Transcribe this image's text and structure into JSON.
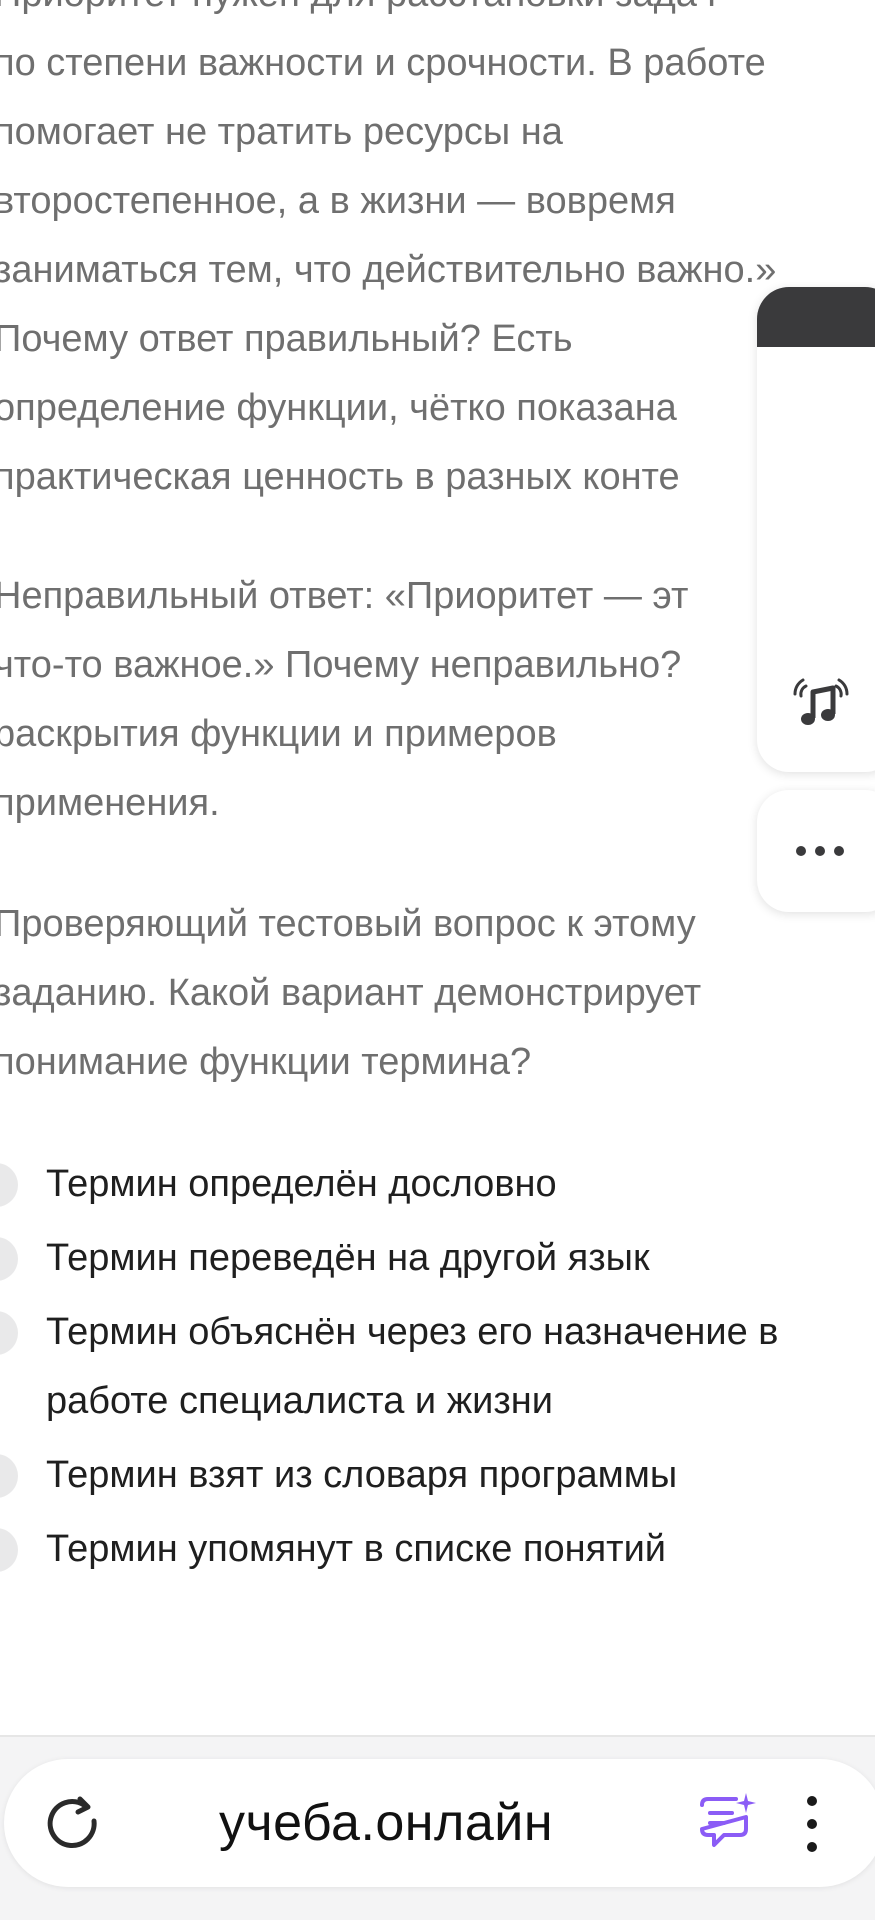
{
  "article": {
    "para1_lines": [
      "Приоритет нужен для расстановки задач",
      "по степени важности и срочности. В работе",
      "помогает не тратить ресурсы на",
      "второстепенное, а в жизни — вовремя",
      "заниматься тем, что действительно важно.»",
      "Почему ответ правильный? Есть",
      "определение функции, чётко показана",
      "практическая ценность в разных конте"
    ],
    "para2_lines": [
      "Неправильный ответ: «Приоритет — эт",
      "что-то важное.» Почему неправильно?",
      "раскрытия функции и примеров",
      "применения."
    ],
    "para3_lines": [
      "Проверяющий тестовый вопрос к этому",
      "заданию. Какой вариант демонстрирует",
      "понимание функции термина?"
    ]
  },
  "quiz": {
    "options": [
      "Термин определён дословно",
      "Термин переведён на другой язык",
      "Термин объяснён через его назначение в работе специалиста и жизни",
      "Термин взят из словаря программы",
      "Термин упомянут в списке понятий"
    ]
  },
  "side_panel": {
    "music_icon": "music-note-icon",
    "more_icon": "more-horizontal-icon"
  },
  "browser": {
    "url": "учеба.онлайн",
    "icons": [
      "reload-icon",
      "assistant-chat-icon",
      "menu-kebab-icon"
    ],
    "accent_color": "#8b5cf6"
  }
}
